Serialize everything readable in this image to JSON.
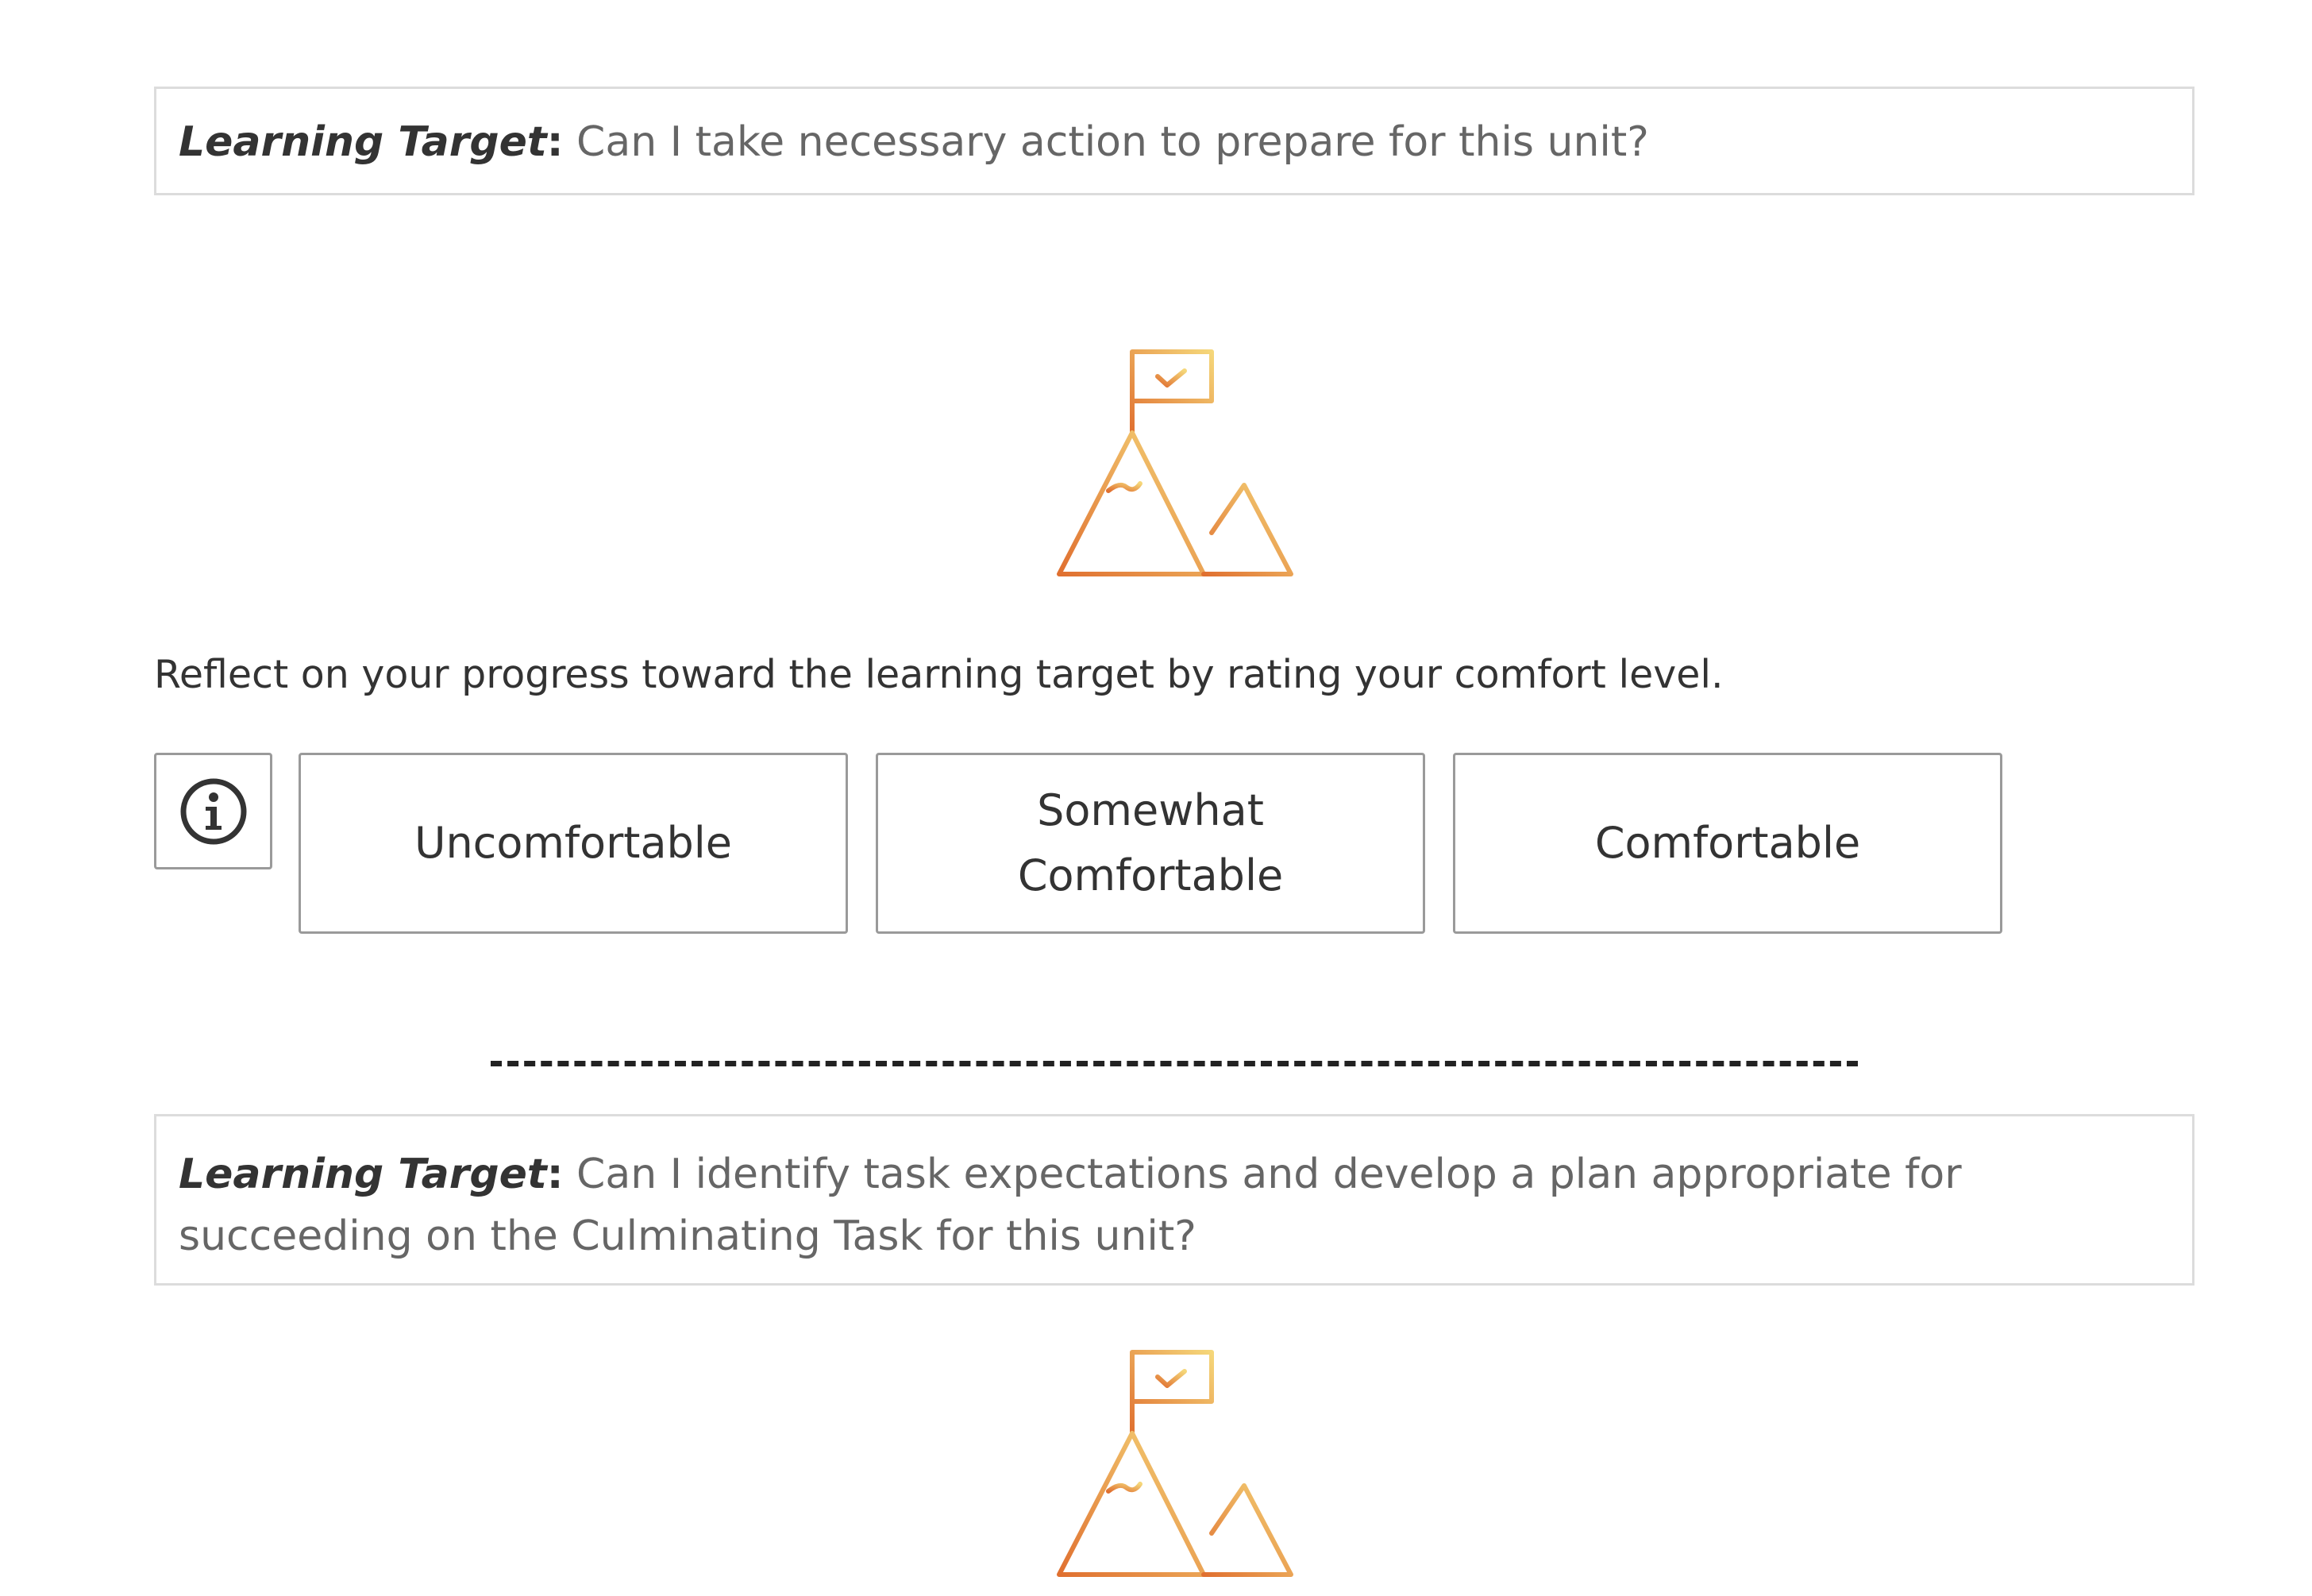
{
  "sections": [
    {
      "learning_target": {
        "label": "Learning Target",
        "colon": ":",
        "question": "Can I take necessary action to prepare for this unit?"
      },
      "icon": "mountain-flag-icon"
    },
    {
      "learning_target": {
        "label": "Learning Target",
        "colon": ":",
        "question": "Can I identify task expectations and develop a plan appropriate for succeeding on the Culminating Task for this unit?"
      },
      "icon": "mountain-flag-icon"
    }
  ],
  "rating": {
    "prompt": "Reflect on your progress toward the learning target by rating your comfort level.",
    "info_icon": "info-circle-icon",
    "options": [
      "Uncomfortable",
      "Somewhat Comfortable",
      "Comfortable"
    ]
  },
  "separator_text": "------------------------------------------------------------------------------------------------",
  "colors": {
    "icon_gradient_start": "#e07030",
    "icon_gradient_end": "#f5d77a",
    "target_border": "#dcdcdc",
    "button_border": "#9a9a9a",
    "text_dark": "#333333",
    "text_muted": "#666666"
  }
}
